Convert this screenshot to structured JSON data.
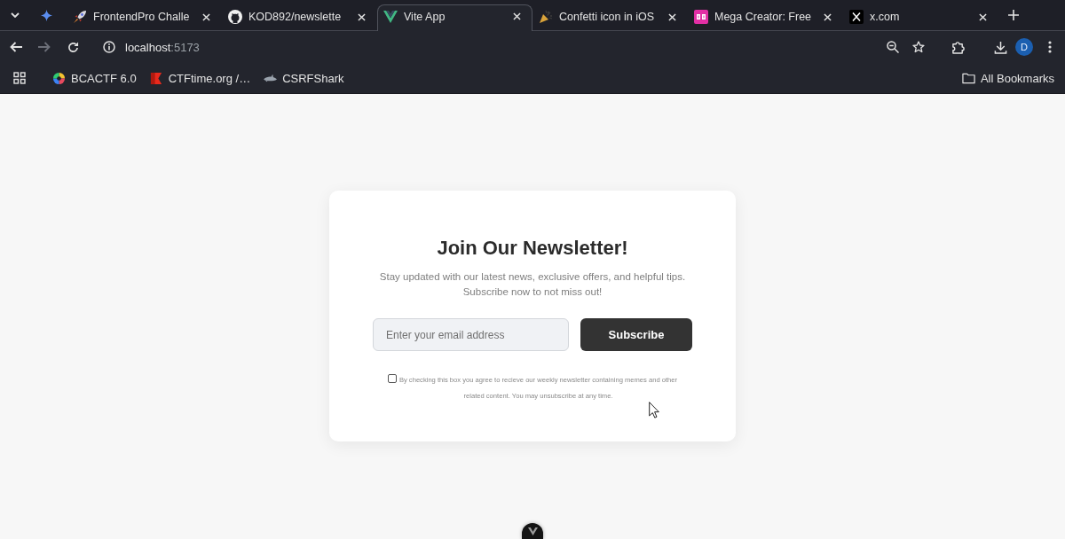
{
  "browser": {
    "tabs": [
      {
        "title": "FrontendPro Challe",
        "selected": false
      },
      {
        "title": "KOD892/newslette",
        "selected": false
      },
      {
        "title": "Vite App",
        "selected": true
      },
      {
        "title": "Confetti icon in iOS",
        "selected": false
      },
      {
        "title": "Mega Creator: Free",
        "selected": false
      },
      {
        "title": "x.com",
        "selected": false
      }
    ],
    "navigation": {
      "back": {
        "disabled": false
      },
      "forward": {
        "disabled": true
      }
    },
    "address": {
      "host": "localhost",
      "port": ":5173"
    },
    "profile": {
      "initial": "D"
    },
    "bookmarks": [
      {
        "label": "BCACTF 6.0"
      },
      {
        "label": "CTFtime.org /…"
      },
      {
        "label": "CSRFShark"
      }
    ],
    "all_bookmarks": "All Bookmarks"
  },
  "newsletter": {
    "title": "Join Our Newsletter!",
    "description": [
      "Stay updated with our latest news, exclusive offers, and helpful tips.",
      "Subscribe now to not miss out!"
    ],
    "email": {
      "placeholder": "Enter your email address"
    },
    "button": "Subscribe",
    "consent": {
      "checked": false,
      "lines": [
        "By checking this box you agree to recieve our weekly newsletter containing memes and other",
        "related content. You may unsubscribe at any time."
      ]
    }
  }
}
